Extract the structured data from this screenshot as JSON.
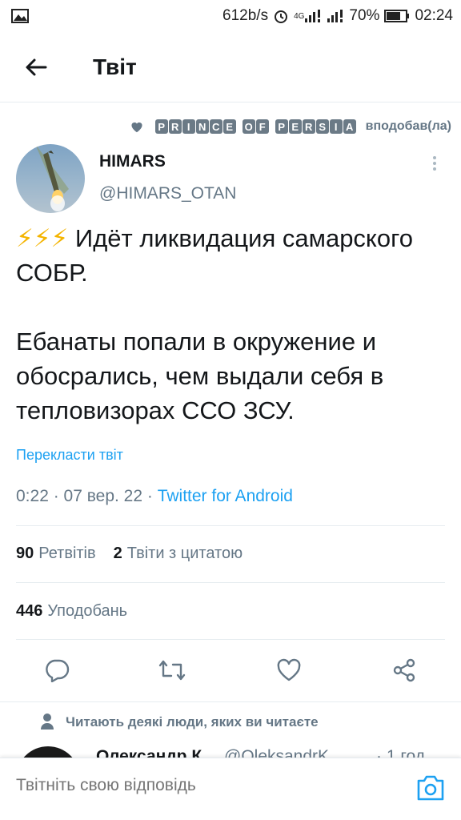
{
  "status_bar": {
    "speed": "612b/s",
    "network": "4G",
    "battery": "70%",
    "time": "02:24"
  },
  "header": {
    "title": "Твіт"
  },
  "liked_by": {
    "name_words": [
      "PRINCE",
      "OF",
      "PERSIA"
    ],
    "action": "вподобав(ла)"
  },
  "tweet": {
    "author_name": "HIMARS",
    "author_handle": "@HIMARS_OTAN",
    "emoji": "⚡⚡⚡",
    "text": " Идёт ликвидация самарского СОБР.\n\nЕбанаты попали в окружение и обосрались, чем выдали себя в тепловизорах ССО ЗСУ.",
    "translate_label": "Перекласти твіт",
    "timestamp": "0:22 · 07 вер. 22 · ",
    "source": "Twitter for Android"
  },
  "stats": {
    "retweets_count": "90",
    "retweets_label": "Ретвітів",
    "quotes_count": "2",
    "quotes_label": "Твіти з цитатою",
    "likes_count": "446",
    "likes_label": "Уподобань"
  },
  "follow_note": "Читають деякі люди, яких ви читаєте",
  "next_tweet": {
    "name": "Олександр К",
    "handle": "@OleksandrK...",
    "time": "· 1 год"
  },
  "reply": {
    "placeholder": "Твітніть свою відповідь"
  },
  "colors": {
    "accent": "#1da1f2",
    "secondary_text": "#657786",
    "divider": "#e6ecf0"
  }
}
